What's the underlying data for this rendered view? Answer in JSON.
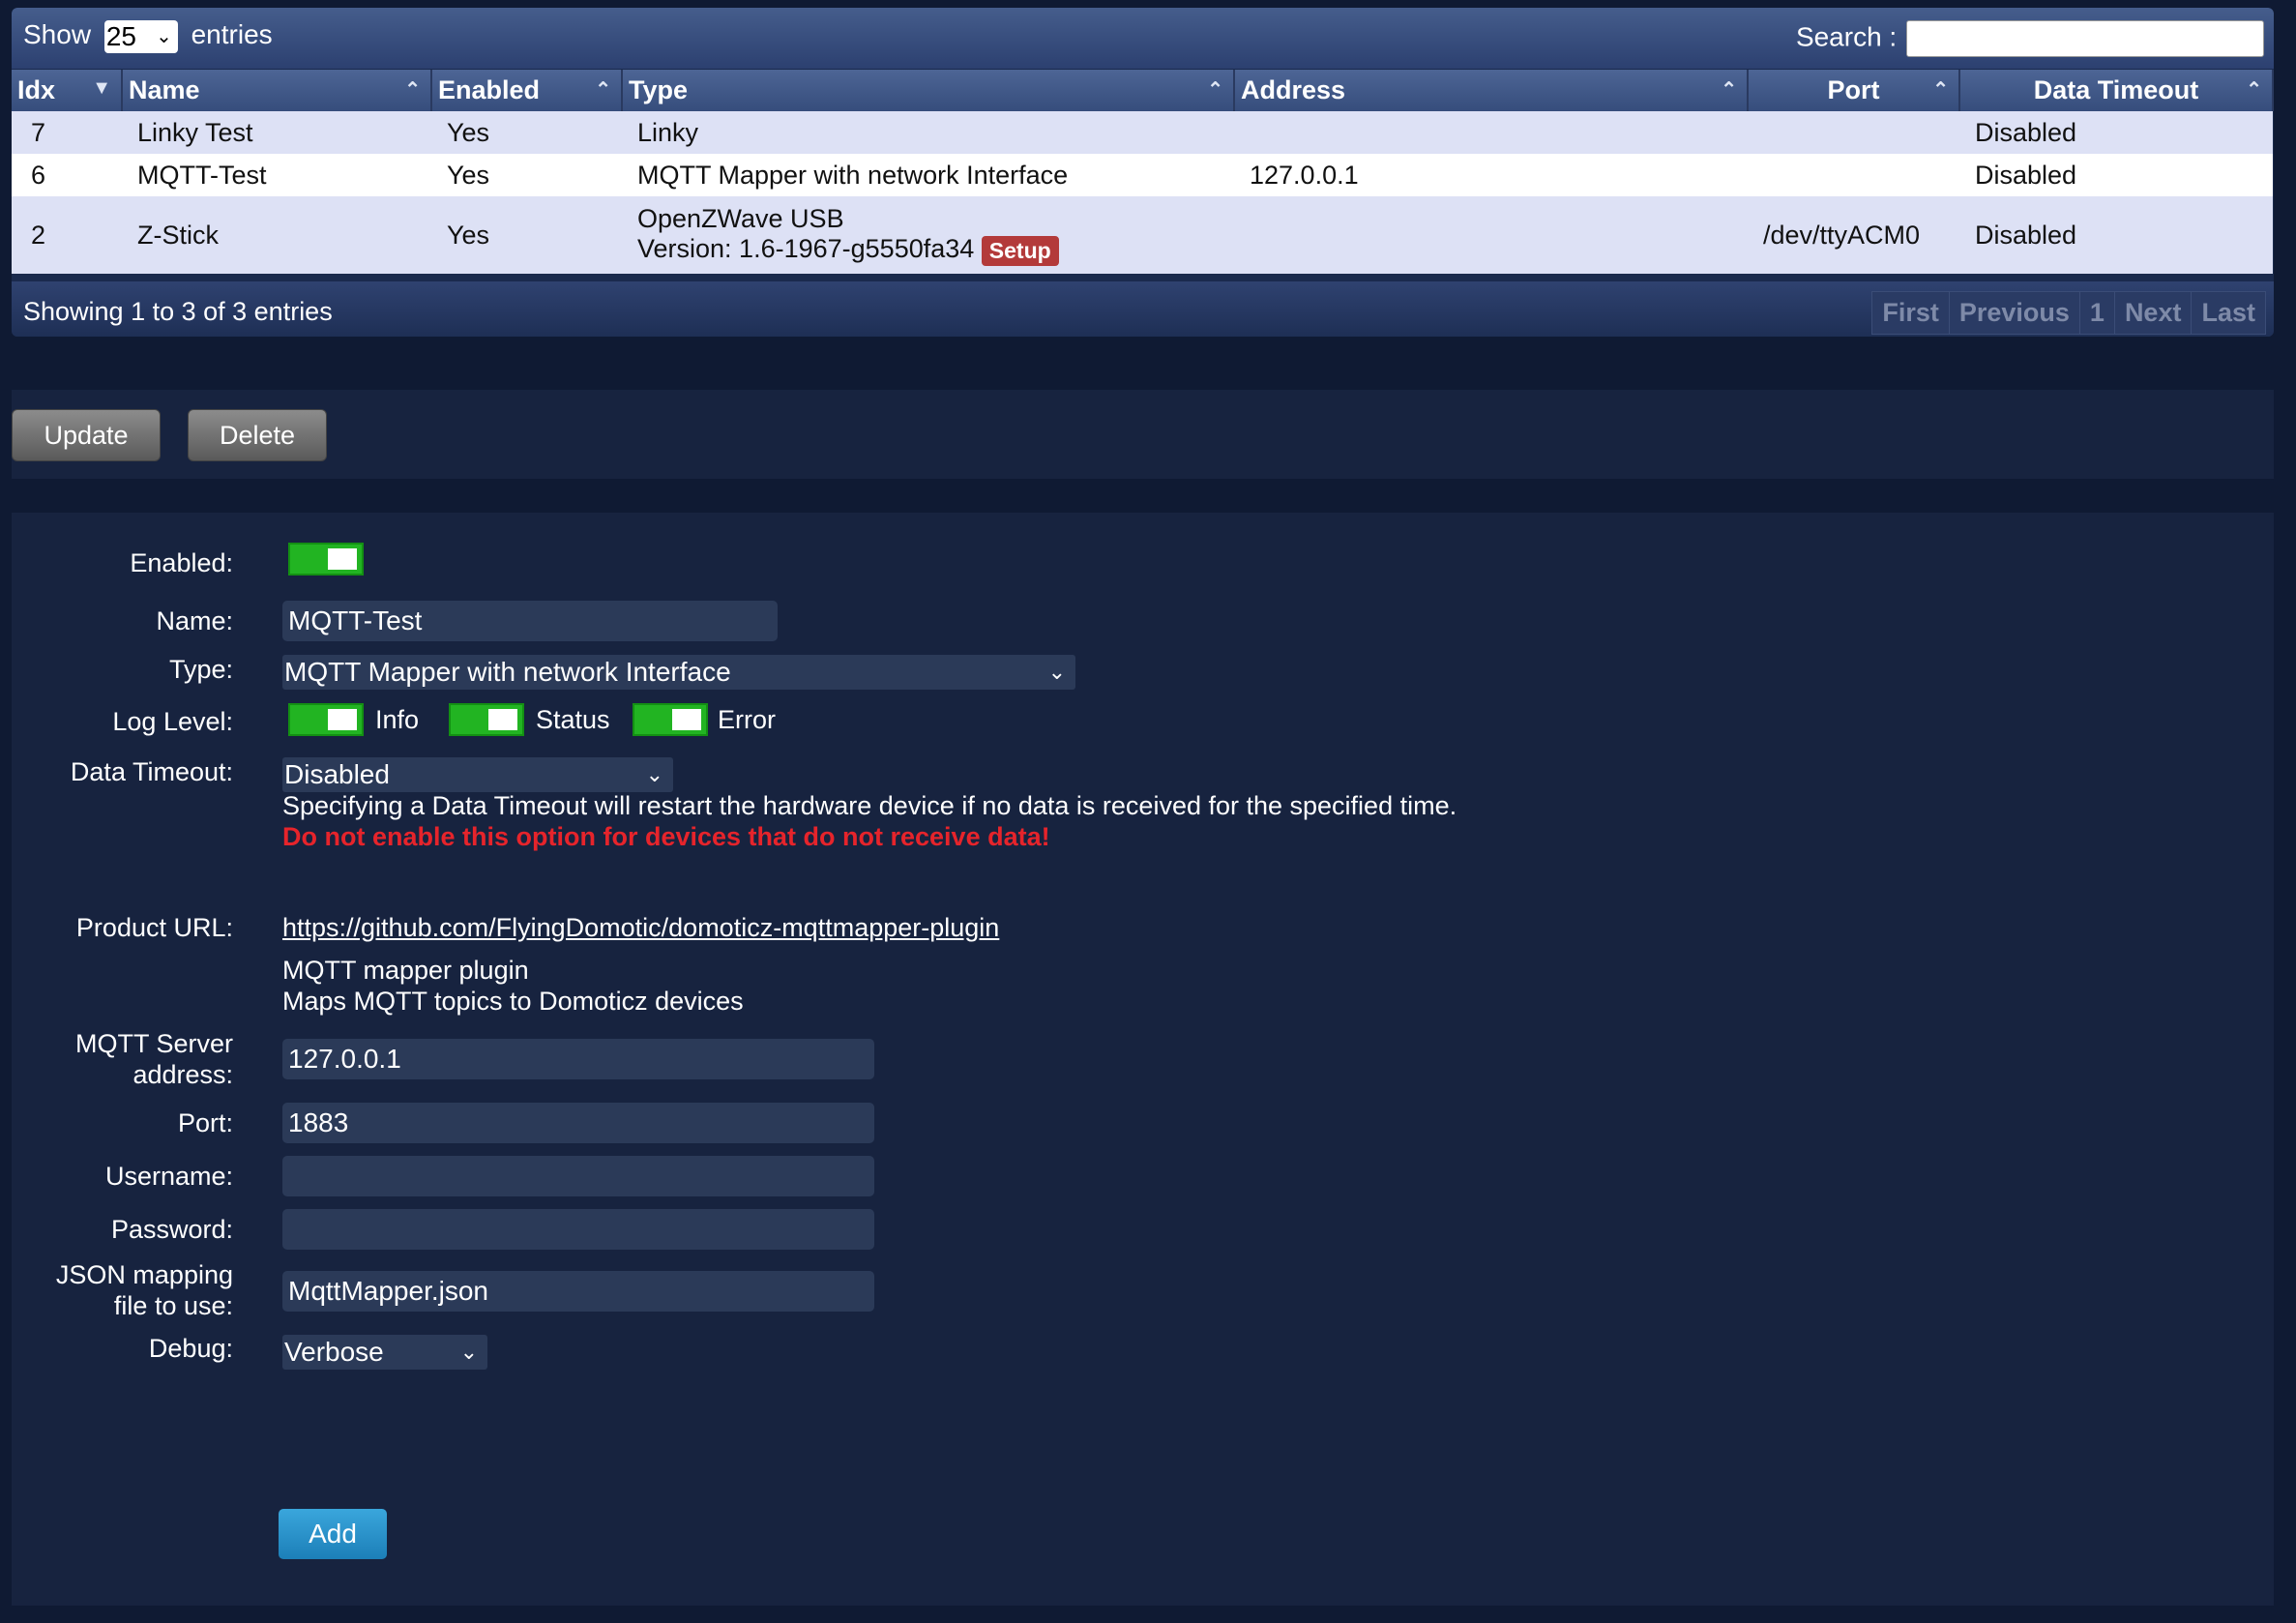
{
  "table": {
    "show_label": "Show",
    "show_value": "25",
    "entries_label": "entries",
    "search_label": "Search :",
    "columns": [
      "Idx",
      "Name",
      "Enabled",
      "Type",
      "Address",
      "Port",
      "Data Timeout"
    ],
    "rows": [
      {
        "idx": "7",
        "name": "Linky Test",
        "enabled": "Yes",
        "type": "Linky",
        "type2": "",
        "address": "",
        "port": "",
        "timeout": "Disabled"
      },
      {
        "idx": "6",
        "name": "MQTT-Test",
        "enabled": "Yes",
        "type": "MQTT Mapper with network Interface",
        "type2": "",
        "address": "127.0.0.1",
        "port": "",
        "timeout": "Disabled"
      },
      {
        "idx": "2",
        "name": "Z-Stick",
        "enabled": "Yes",
        "type": "OpenZWave USB",
        "type2": "Version: 1.6-1967-g5550fa34",
        "address": "",
        "port": "/dev/ttyACM0",
        "timeout": "Disabled"
      }
    ],
    "setup_label": "Setup",
    "showing_text": "Showing 1 to 3 of 3 entries",
    "pager": [
      "First",
      "Previous",
      "1",
      "Next",
      "Last"
    ]
  },
  "actions": {
    "update": "Update",
    "delete": "Delete"
  },
  "form": {
    "enabled_label": "Enabled:",
    "name_label": "Name:",
    "name_value": "MQTT-Test",
    "type_label": "Type:",
    "type_value": "MQTT Mapper with network Interface",
    "loglevel_label": "Log Level:",
    "loglevel_info": "Info",
    "loglevel_status": "Status",
    "loglevel_error": "Error",
    "timeout_label": "Data Timeout:",
    "timeout_value": "Disabled",
    "timeout_help": "Specifying a Data Timeout will restart the hardware device if no data is received for the specified time.",
    "timeout_warning": "Do not enable this option for devices that do not receive data!",
    "product_url_label": "Product URL:",
    "product_url": "https://github.com/FlyingDomotic/domoticz-mqttmapper-plugin",
    "plugin_name": "MQTT mapper plugin",
    "plugin_desc": "Maps MQTT topics to Domoticz devices",
    "server_label_1": "MQTT Server",
    "server_label_2": "address:",
    "server_value": "127.0.0.1",
    "port_label": "Port:",
    "port_value": "1883",
    "username_label": "Username:",
    "username_value": "",
    "password_label": "Password:",
    "password_value": "",
    "json_label_1": "JSON mapping",
    "json_label_2": "file to use:",
    "json_value": "MqttMapper.json",
    "debug_label": "Debug:",
    "debug_value": "Verbose",
    "add_label": "Add"
  },
  "colors": {
    "toggle_on": "#22b422",
    "warning": "#e6242b",
    "add_button": "#2a93cc",
    "setup_badge": "#b33a3a"
  }
}
